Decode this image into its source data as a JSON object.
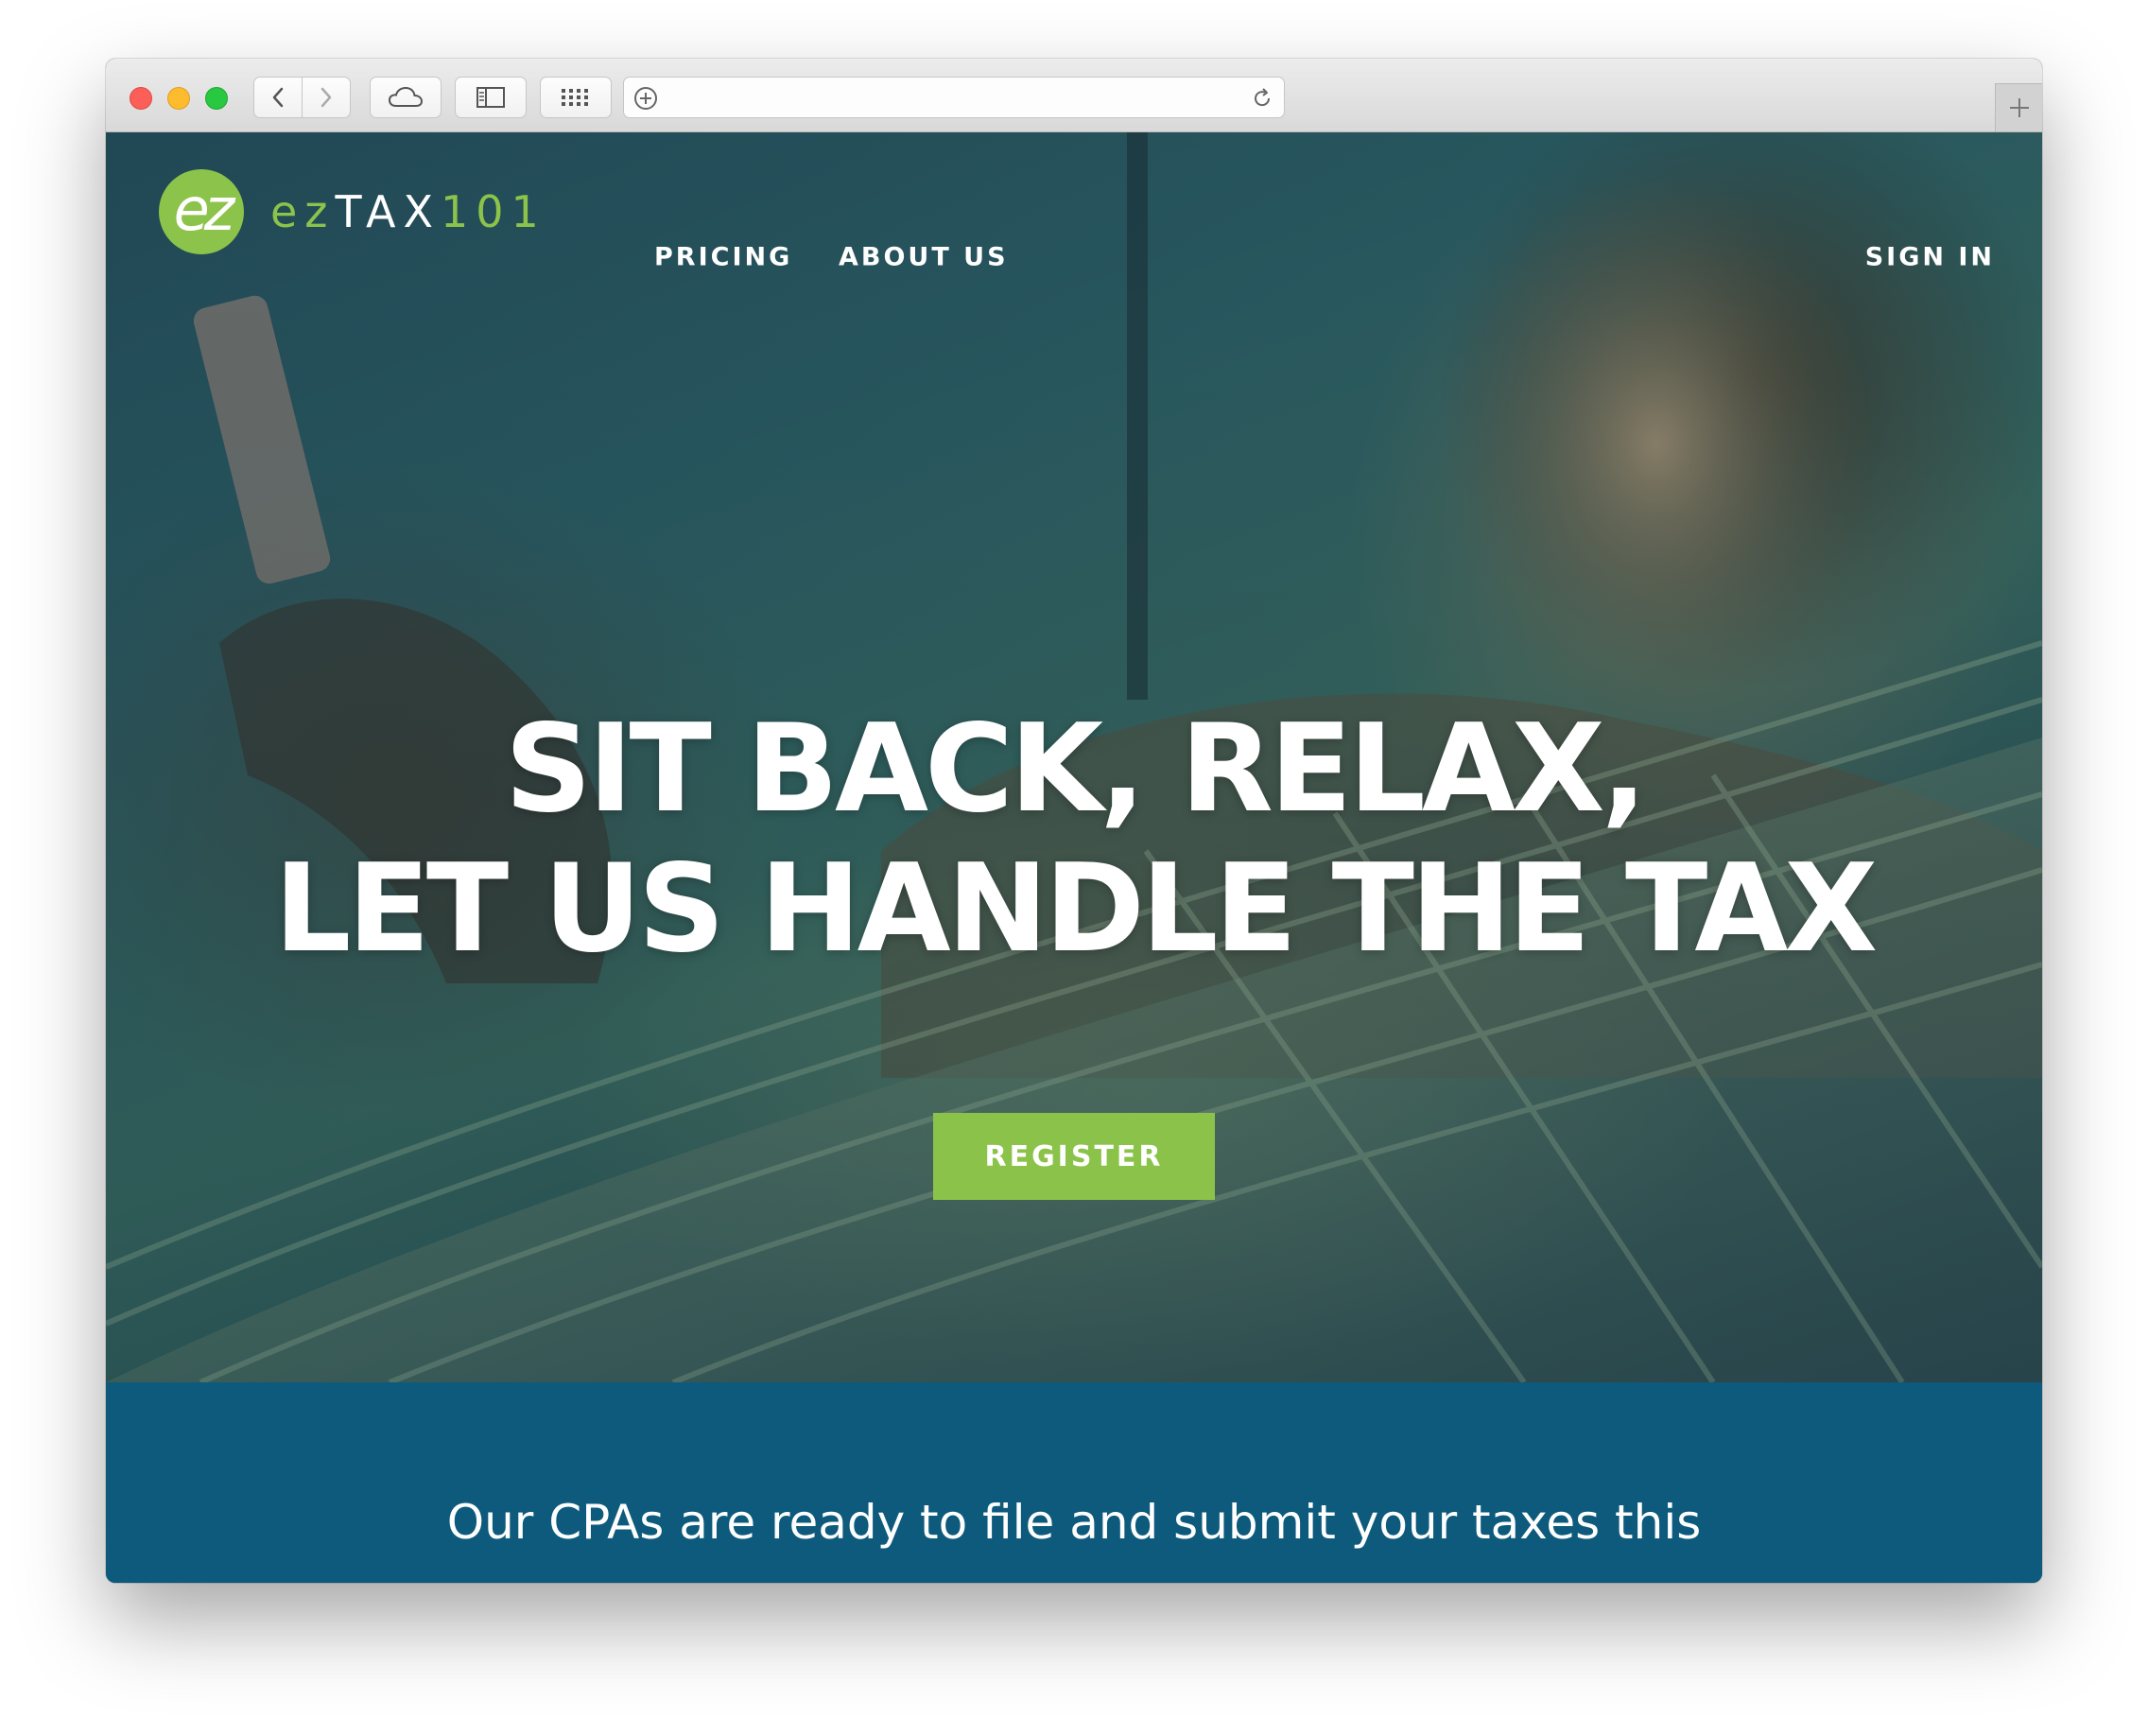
{
  "browser": {
    "buttons": {
      "back": "chevron-left-icon",
      "forward": "chevron-right-icon",
      "icloud": "cloud-icon",
      "sidebar": "sidebar-icon",
      "tabs_overview": "grid-icon",
      "add_bookmark": "plus-circle-icon",
      "reload": "reload-icon",
      "new_tab": "plus-icon"
    }
  },
  "site": {
    "logo": {
      "mark": "ez",
      "ez": "ez",
      "tax": "TAX",
      "num": "101"
    },
    "nav": {
      "pricing": "PRICING",
      "about": "ABOUT US",
      "sign_in": "SIGN IN"
    },
    "hero": {
      "headline_line1": "SIT BACK, RELAX,",
      "headline_line2": "LET US HANDLE THE TAX",
      "register_label": "REGISTER"
    },
    "band": {
      "text": "Our CPAs are ready to file and submit your taxes this"
    },
    "colors": {
      "brand_green": "#8bc34a",
      "band_blue": "#0d5a7c"
    }
  }
}
